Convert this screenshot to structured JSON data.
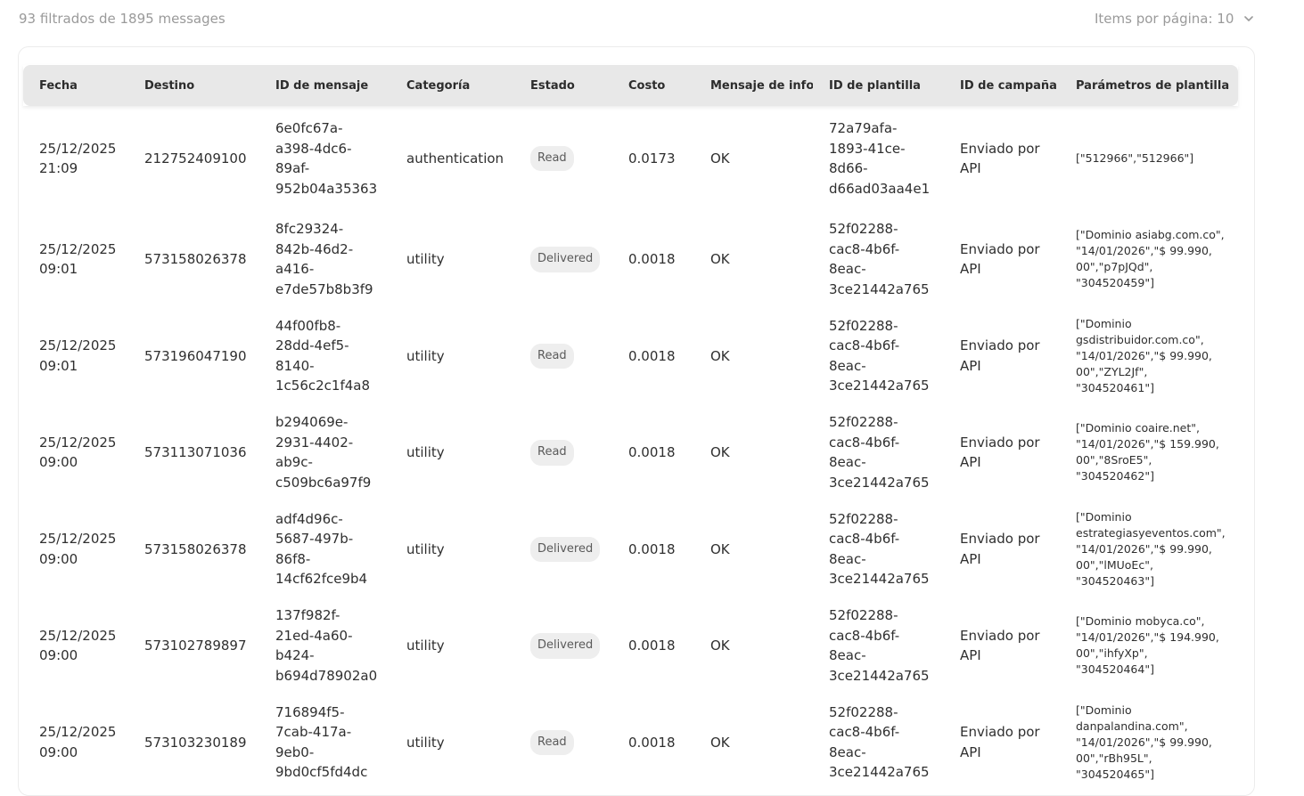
{
  "summary": "93 filtrados de 1895 messages",
  "per_page": {
    "label": "Items por página: 10",
    "icon": "chevron-down-icon"
  },
  "columns": [
    "Fecha",
    "Destino",
    "ID de mensaje",
    "Categoría",
    "Estado",
    "Costo",
    "Mensaje de info",
    "ID de plantilla",
    "ID de campaña",
    "Parámetros de plantilla"
  ],
  "rows": [
    {
      "fecha": "25/12/2025\n21:09",
      "destino": "212752409100",
      "id_mensaje": "6e0fc67a-\na398-4dc6-\n89af-\n952b04a35363",
      "categoria": "authentication",
      "estado": "Read",
      "costo": "0.0173",
      "info": "OK",
      "id_plantilla": "72a79afa-\n1893-41ce-\n8d66-\nd66ad03aa4e1",
      "campana": "Enviado por\nAPI",
      "parametros": "[\"512966\",\"512966\"]"
    },
    {
      "fecha": "25/12/2025\n09:01",
      "destino": "573158026378",
      "id_mensaje": "8fc29324-\n842b-46d2-\na416-\ne7de57b8b3f9",
      "categoria": "utility",
      "estado": "Delivered",
      "costo": "0.0018",
      "info": "OK",
      "id_plantilla": "52f02288-\ncac8-4b6f-\n8eac-\n3ce21442a765",
      "campana": "Enviado por\nAPI",
      "parametros": "[\"Dominio asiabg.com.co\",\n\"14/01/2026\",\"$ 99.990,\n00\",\"p7pJQd\",\n\"304520459\"]"
    },
    {
      "fecha": "25/12/2025\n09:01",
      "destino": "573196047190",
      "id_mensaje": "44f00fb8-\n28dd-4ef5-\n8140-\n1c56c2c1f4a8",
      "categoria": "utility",
      "estado": "Read",
      "costo": "0.0018",
      "info": "OK",
      "id_plantilla": "52f02288-\ncac8-4b6f-\n8eac-\n3ce21442a765",
      "campana": "Enviado por\nAPI",
      "parametros": "[\"Dominio\ngsdistribuidor.com.co\",\n\"14/01/2026\",\"$ 99.990,\n00\",\"ZYL2Jf\",\n\"304520461\"]"
    },
    {
      "fecha": "25/12/2025\n09:00",
      "destino": "573113071036",
      "id_mensaje": "b294069e-\n2931-4402-\nab9c-\nc509bc6a97f9",
      "categoria": "utility",
      "estado": "Read",
      "costo": "0.0018",
      "info": "OK",
      "id_plantilla": "52f02288-\ncac8-4b6f-\n8eac-\n3ce21442a765",
      "campana": "Enviado por\nAPI",
      "parametros": "[\"Dominio coaire.net\",\n\"14/01/2026\",\"$ 159.990,\n00\",\"8SroE5\",\n\"304520462\"]"
    },
    {
      "fecha": "25/12/2025\n09:00",
      "destino": "573158026378",
      "id_mensaje": "adf4d96c-\n5687-497b-\n86f8-\n14cf62fce9b4",
      "categoria": "utility",
      "estado": "Delivered",
      "costo": "0.0018",
      "info": "OK",
      "id_plantilla": "52f02288-\ncac8-4b6f-\n8eac-\n3ce21442a765",
      "campana": "Enviado por\nAPI",
      "parametros": "[\"Dominio\nestrategiasyeventos.com\",\n\"14/01/2026\",\"$ 99.990,\n00\",\"lMUoEc\",\n\"304520463\"]"
    },
    {
      "fecha": "25/12/2025\n09:00",
      "destino": "573102789897",
      "id_mensaje": "137f982f-\n21ed-4a60-\nb424-\nb694d78902a0",
      "categoria": "utility",
      "estado": "Delivered",
      "costo": "0.0018",
      "info": "OK",
      "id_plantilla": "52f02288-\ncac8-4b6f-\n8eac-\n3ce21442a765",
      "campana": "Enviado por\nAPI",
      "parametros": "[\"Dominio mobyca.co\",\n\"14/01/2026\",\"$ 194.990,\n00\",\"ihfyXp\",\n\"304520464\"]"
    },
    {
      "fecha": "25/12/2025\n09:00",
      "destino": "573103230189",
      "id_mensaje": "716894f5-\n7cab-417a-\n9eb0-\n9bd0cf5fd4dc",
      "categoria": "utility",
      "estado": "Read",
      "costo": "0.0018",
      "info": "OK",
      "id_plantilla": "52f02288-\ncac8-4b6f-\n8eac-\n3ce21442a765",
      "campana": "Enviado por\nAPI",
      "parametros": "[\"Dominio\ndanpalandina.com\",\n\"14/01/2026\",\"$ 99.990,\n00\",\"rBh95L\",\n\"304520465\"]"
    }
  ]
}
